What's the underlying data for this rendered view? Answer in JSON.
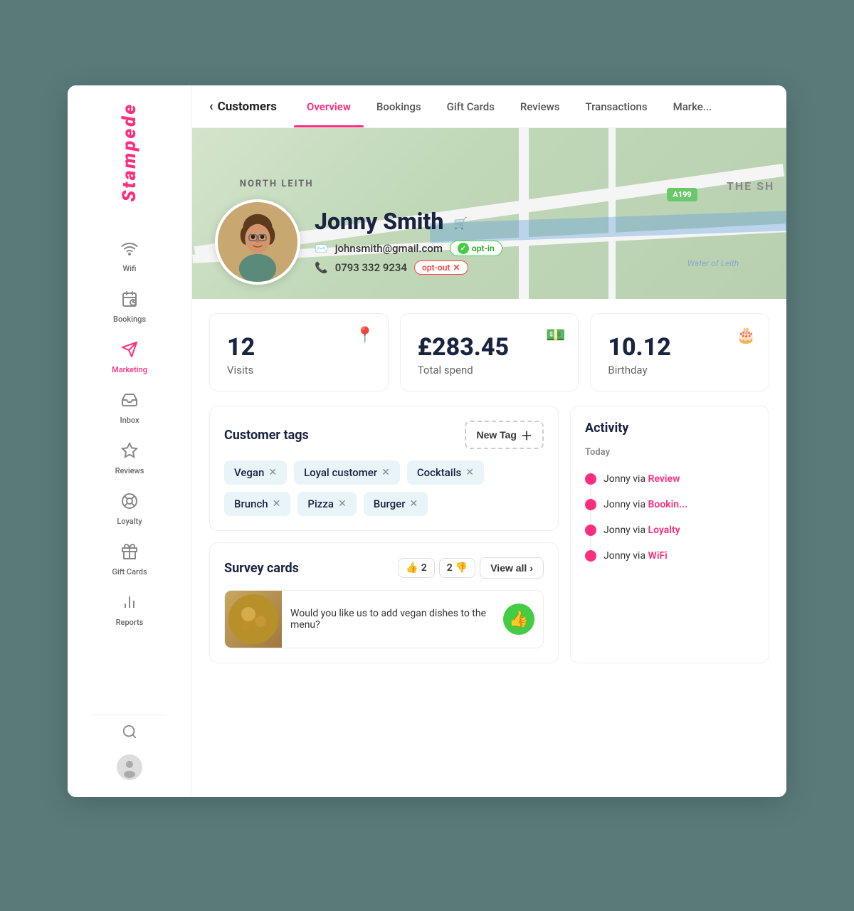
{
  "app": {
    "logo": "Stampede"
  },
  "sidebar": {
    "items": [
      {
        "id": "wifi",
        "label": "Wifi",
        "icon": "📶",
        "active": false
      },
      {
        "id": "bookings",
        "label": "Bookings",
        "icon": "📅",
        "active": false
      },
      {
        "id": "marketing",
        "label": "Marketing",
        "icon": "✈️",
        "active": false
      },
      {
        "id": "inbox",
        "label": "Inbox",
        "icon": "📥",
        "active": false
      },
      {
        "id": "reviews",
        "label": "Reviews",
        "icon": "⭐",
        "active": false
      },
      {
        "id": "loyalty",
        "label": "Loyalty",
        "icon": "🎯",
        "active": false
      },
      {
        "id": "giftcards",
        "label": "Gift Cards",
        "icon": "🎁",
        "active": false
      },
      {
        "id": "reports",
        "label": "Reports",
        "icon": "📊",
        "active": false
      }
    ]
  },
  "topnav": {
    "back_label": "Customers",
    "tabs": [
      {
        "id": "overview",
        "label": "Overview",
        "active": true
      },
      {
        "id": "bookings",
        "label": "Bookings",
        "active": false
      },
      {
        "id": "giftcards",
        "label": "Gift Cards",
        "active": false
      },
      {
        "id": "reviews",
        "label": "Reviews",
        "active": false
      },
      {
        "id": "transactions",
        "label": "Transactions",
        "active": false
      },
      {
        "id": "marketing",
        "label": "Marke...",
        "active": false
      }
    ]
  },
  "profile": {
    "name": "Jonny Smith",
    "email": "johnsmith@gmail.com",
    "email_status": "opt-in",
    "phone": "0793 332 9234",
    "phone_status": "opt-out",
    "map_label": "NORTH LEITH",
    "map_badge": "A199",
    "map_water": "Water of Leith",
    "map_sh": "THE SH"
  },
  "stats": [
    {
      "id": "visits",
      "value": "12",
      "label": "Visits",
      "icon": "📍"
    },
    {
      "id": "spend",
      "value": "£283.45",
      "label": "Total spend",
      "icon": "💵"
    },
    {
      "id": "birthday",
      "value": "10.12",
      "label": "Birthday",
      "icon": "🎂"
    }
  ],
  "customer_tags": {
    "title": "Customer tags",
    "new_tag_label": "New Tag",
    "tags": [
      {
        "label": "Vegan"
      },
      {
        "label": "Loyal customer"
      },
      {
        "label": "Cocktails"
      },
      {
        "label": "Brunch"
      },
      {
        "label": "Pizza"
      },
      {
        "label": "Burger"
      }
    ]
  },
  "survey_cards": {
    "title": "Survey cards",
    "thumbs_up_count": "2",
    "thumbs_down_count": "2",
    "view_all_label": "View all",
    "item": {
      "question": "Would  you like us to add vegan dishes to the menu?"
    }
  },
  "activity": {
    "title": "Activity",
    "today_label": "Today",
    "items": [
      {
        "text": "Jonny via ",
        "link": "Review",
        "link_type": "review"
      },
      {
        "text": "Jonny via ",
        "link": "Bookin...",
        "link_type": "booking"
      },
      {
        "text": "Jonny via ",
        "link": "Loyalty",
        "link_type": "loyalty"
      },
      {
        "text": "Jonny via ",
        "link": "WiFi",
        "link_type": "wifi"
      }
    ]
  }
}
